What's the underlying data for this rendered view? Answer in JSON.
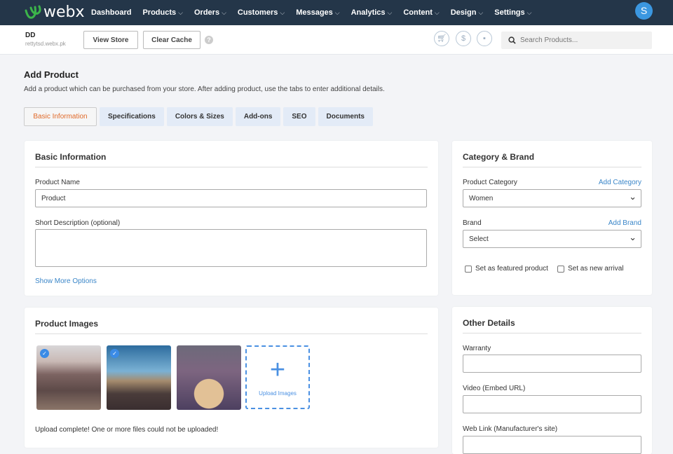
{
  "nav": {
    "brand": "webx",
    "items": [
      "Dashboard",
      "Products",
      "Orders",
      "Customers",
      "Messages",
      "Analytics",
      "Content",
      "Design",
      "Settings"
    ],
    "dropdown": [
      false,
      true,
      true,
      true,
      true,
      true,
      true,
      true,
      true
    ],
    "avatar": "S"
  },
  "subheader": {
    "store_name": "DD",
    "store_url": "rettytsd.webx.pk",
    "view_store": "View Store",
    "clear_cache": "Clear Cache",
    "help": "?",
    "search_placeholder": "Search Products..."
  },
  "page": {
    "title": "Add Product",
    "description": "Add a product which can be purchased from your store. After adding product, use the tabs to enter additional details.",
    "tabs": [
      "Basic Information",
      "Specifications",
      "Colors & Sizes",
      "Add-ons",
      "SEO",
      "Documents"
    ]
  },
  "basic": {
    "title": "Basic Information",
    "name_label": "Product Name",
    "name_value": "Product",
    "short_label": "Short Description (optional)",
    "more": "Show More Options"
  },
  "category": {
    "title": "Category & Brand",
    "cat_label": "Product Category",
    "add_cat": "Add Category",
    "cat_value": "Women",
    "brand_label": "Brand",
    "add_brand": "Add Brand",
    "brand_value": "Select",
    "featured": "Set as featured product",
    "new_arrival": "Set as new arrival"
  },
  "images": {
    "title": "Product Images",
    "upload": "Upload Images",
    "status": "Upload complete! One or more files could not be uploaded!"
  },
  "other": {
    "title": "Other Details",
    "warranty": "Warranty",
    "video": "Video (Embed URL)",
    "weblink": "Web Link (Manufacturer's site)"
  }
}
